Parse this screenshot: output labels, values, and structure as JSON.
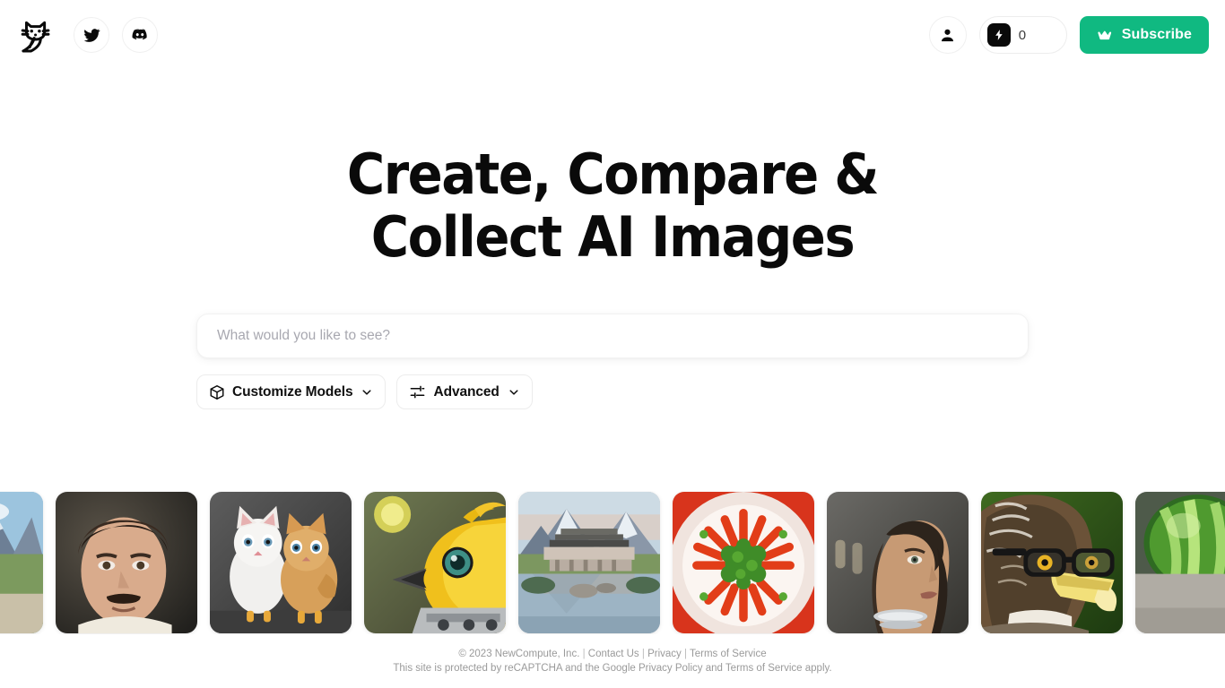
{
  "header": {
    "logo": {
      "icon": "cat-logo-icon",
      "alt": "NewCompute cat logo"
    },
    "social": [
      {
        "icon": "twitter-icon",
        "label": "Twitter"
      },
      {
        "icon": "discord-icon",
        "label": "Discord"
      }
    ],
    "account": {
      "icon": "user-avatar-icon",
      "label": "Account"
    },
    "credits": {
      "icon": "lightning-bolt-icon",
      "count": "0"
    },
    "subscribe": {
      "icon": "crown-icon",
      "label": "Subscribe"
    }
  },
  "hero": {
    "title_line1": "Create, Compare &",
    "title_line2": "Collect AI Images"
  },
  "prompt": {
    "placeholder": "What would you like to see?",
    "value": ""
  },
  "options": [
    {
      "icon": "cube-icon",
      "label": "Customize Models",
      "chevron": "chevron-down-icon"
    },
    {
      "icon": "sliders-icon",
      "label": "Advanced",
      "chevron": "chevron-down-icon"
    }
  ],
  "gallery": [
    {
      "alt": "Wooden mountain lodge with snowy peaks"
    },
    {
      "alt": "Portrait of a man with a moustache"
    },
    {
      "alt": "White kitten beside a kitten-chicken hybrid"
    },
    {
      "alt": "Yellow robotic bird of prey close-up"
    },
    {
      "alt": "Modern mountain house reflected in a lake"
    },
    {
      "alt": "Plate of baby carrots with parsley"
    },
    {
      "alt": "Woman in profile with wet hair and choker"
    },
    {
      "alt": "Bald eagle wearing black eyeglasses"
    },
    {
      "alt": "Green watermelon on pavement"
    }
  ],
  "footer": {
    "copyright": "© 2023 NewCompute, Inc.",
    "sep": "|",
    "contact": "Contact Us",
    "privacy": "Privacy",
    "terms": "Terms of Service",
    "recaptcha_prefix": "This site is protected by reCAPTCHA and the Google ",
    "recaptcha_privacy": "Privacy Policy",
    "recaptcha_and": " and ",
    "recaptcha_terms": "Terms of Service",
    "recaptcha_suffix": " apply."
  },
  "colors": {
    "accent_green": "#10b981",
    "background": "#ffffff",
    "text": "#0a0a0a",
    "muted": "#9a9a9a",
    "placeholder": "#a8a8b0"
  }
}
